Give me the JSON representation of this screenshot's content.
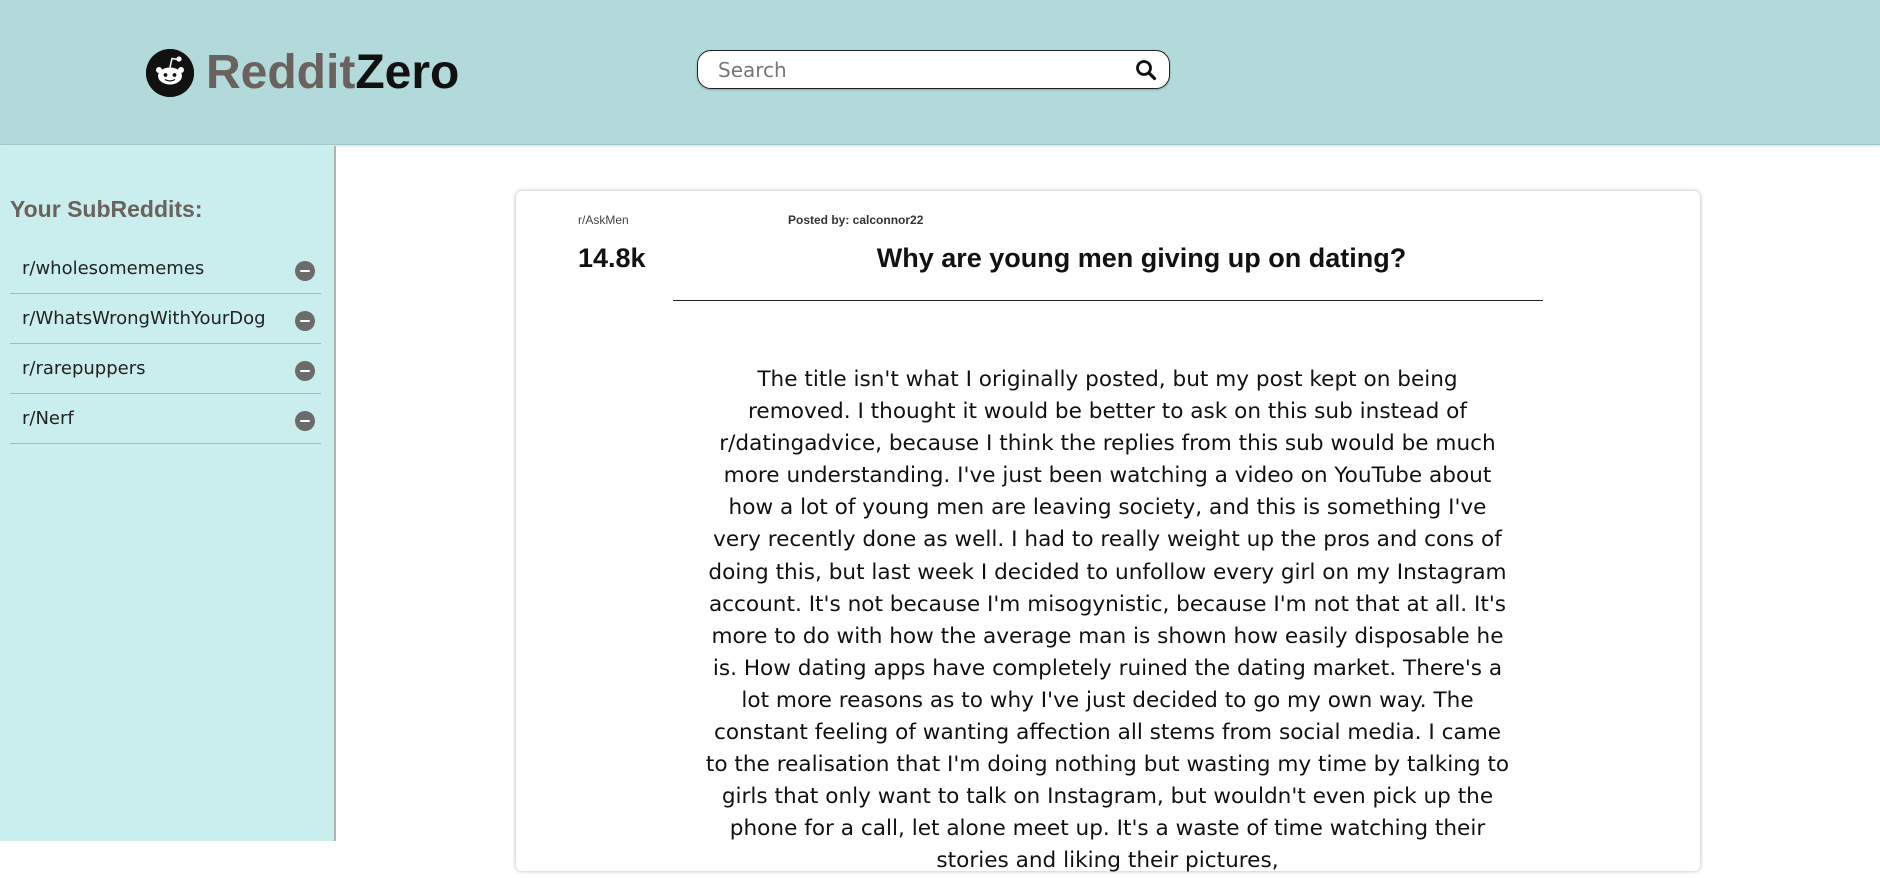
{
  "header": {
    "logo_part1": "Reddit",
    "logo_part2": "Zero",
    "search_placeholder": "Search"
  },
  "icons": {
    "logo": "reddit-alien-icon",
    "search": "magnifier-icon",
    "remove": "minus-circle-icon"
  },
  "colors": {
    "header_bg": "#b2dada",
    "sidebar_bg": "#caeded",
    "brand_grey": "#6b615e"
  },
  "sidebar": {
    "title": "Your SubReddits:",
    "items": [
      {
        "label": "r/wholesomememes"
      },
      {
        "label": "r/WhatsWrongWithYourDog"
      },
      {
        "label": "r/rarepuppers"
      },
      {
        "label": "r/Nerf"
      }
    ]
  },
  "post": {
    "subreddit": "r/AskMen",
    "author_line": "Posted by: calconnor22",
    "votes": "14.8k",
    "title": "Why are young men giving up on dating?",
    "body": "The title isn't what I originally posted, but my post kept on being removed. I thought it would be better to ask on this sub instead of r/datingadvice, because I think the replies from this sub would be much more understanding. I've just been watching a video on YouTube about how a lot of young men are leaving society, and this is something I've very recently done as well. I had to really weight up the pros and cons of doing this, but last week I decided to unfollow every girl on my Instagram account. It's not because I'm misogynistic, because I'm not that at all. It's more to do with how the average man is shown how easily disposable he is. How dating apps have completely ruined the dating market. There's a lot more reasons as to why I've just decided to go my own way. The constant feeling of wanting affection all stems from social media. I came to the realisation that I'm doing nothing but wasting my time by talking to girls that only want to talk on Instagram, but wouldn't even pick up the phone for a call, let alone meet up. It's a waste of time watching their stories and liking their pictures,"
  }
}
